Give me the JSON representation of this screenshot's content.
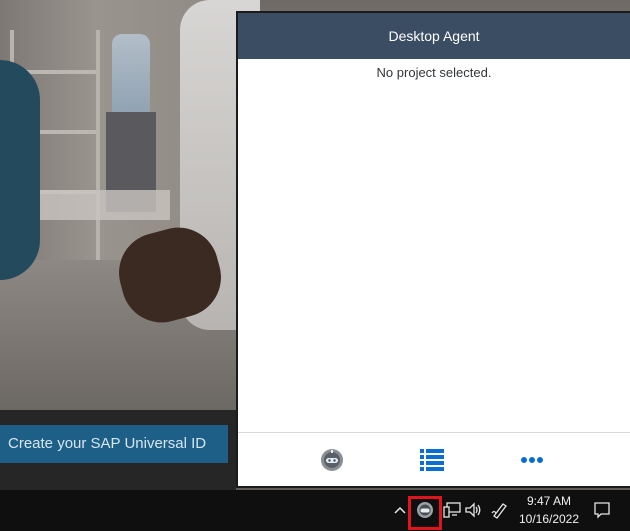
{
  "background": {
    "sap_button_label": "Create your SAP Universal ID"
  },
  "agent_window": {
    "title": "Desktop Agent",
    "message": "No project selected.",
    "footer": {
      "left_icon": "agent-robot-icon",
      "middle_icon": "list-icon",
      "right_icon": "more-icon"
    },
    "accent_color": "#0a6ed1",
    "header_color": "#3a4d63"
  },
  "taskbar": {
    "time": "9:47 AM",
    "date": "10/16/2022",
    "tray_icons": [
      "show-hidden-icons-chevron",
      "desktop-agent-tray-icon",
      "network-icon",
      "volume-icon",
      "pen-icon",
      "notifications-icon"
    ],
    "highlight_color": "#e0141c"
  }
}
